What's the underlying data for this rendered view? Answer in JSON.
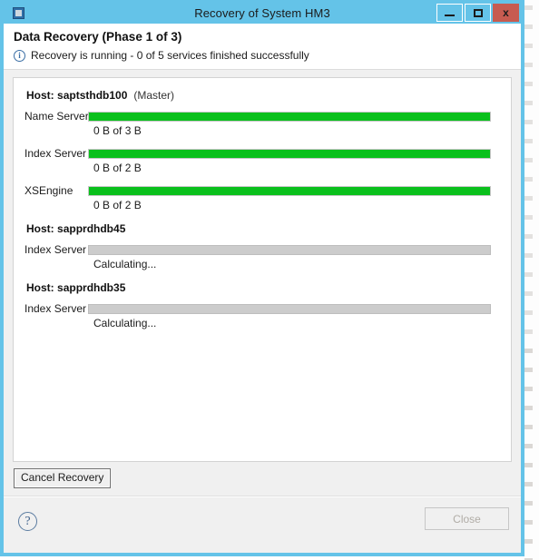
{
  "window": {
    "title": "Recovery of System HM3",
    "app_icon": "application-icon",
    "controls": {
      "minimize_label": "–",
      "maximize_label": "□",
      "close_label": "x"
    },
    "title_bar_color": "#64c3e8",
    "close_button_color": "#c75b50"
  },
  "header": {
    "title": "Data Recovery (Phase 1 of 3)",
    "status_icon": "info-icon",
    "status_text": "Recovery is running - 0 of 5 services finished successfully"
  },
  "progress": {
    "progress_color": "#0ac01c",
    "track_color": "#cccccc",
    "hosts": [
      {
        "host_label": "Host:",
        "host_name": "saptsthdb100",
        "role": "(Master)",
        "services": [
          {
            "name": "Name Server",
            "status": "0 B of 3 B",
            "percent": 100,
            "indeterminate": false
          },
          {
            "name": "Index Server",
            "status": "0 B of 2 B",
            "percent": 100,
            "indeterminate": false
          },
          {
            "name": "XSEngine",
            "status": "0 B of 2 B",
            "percent": 100,
            "indeterminate": false
          }
        ]
      },
      {
        "host_label": "Host:",
        "host_name": "sapprdhdb45",
        "role": "",
        "services": [
          {
            "name": "Index Server",
            "status": "Calculating...",
            "percent": 0,
            "indeterminate": true
          }
        ]
      },
      {
        "host_label": "Host:",
        "host_name": "sapprdhdb35",
        "role": "",
        "services": [
          {
            "name": "Index Server",
            "status": "Calculating...",
            "percent": 0,
            "indeterminate": true
          }
        ]
      }
    ]
  },
  "actions": {
    "cancel_recovery_label": "Cancel Recovery"
  },
  "footer": {
    "help_label": "?",
    "close_label": "Close"
  }
}
